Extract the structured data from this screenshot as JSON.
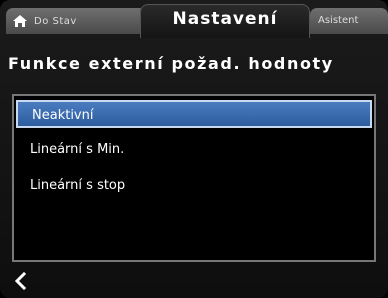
{
  "header": {
    "tab_left_label": "Do Stav",
    "title": "Nastavení",
    "tab_right_label": "Asistent",
    "subhint": ""
  },
  "page": {
    "title": "Funkce externí požad. hodnoty"
  },
  "options": [
    {
      "label": "Neaktivní",
      "selected": true
    },
    {
      "label": "Lineární s Min.",
      "selected": false
    },
    {
      "label": "Lineární s stop",
      "selected": false
    }
  ],
  "colors": {
    "selection": "#3a6db0",
    "background": "#111111",
    "text": "#ffffff"
  },
  "icons": {
    "home": "home-icon",
    "back": "back-arrow-icon"
  }
}
